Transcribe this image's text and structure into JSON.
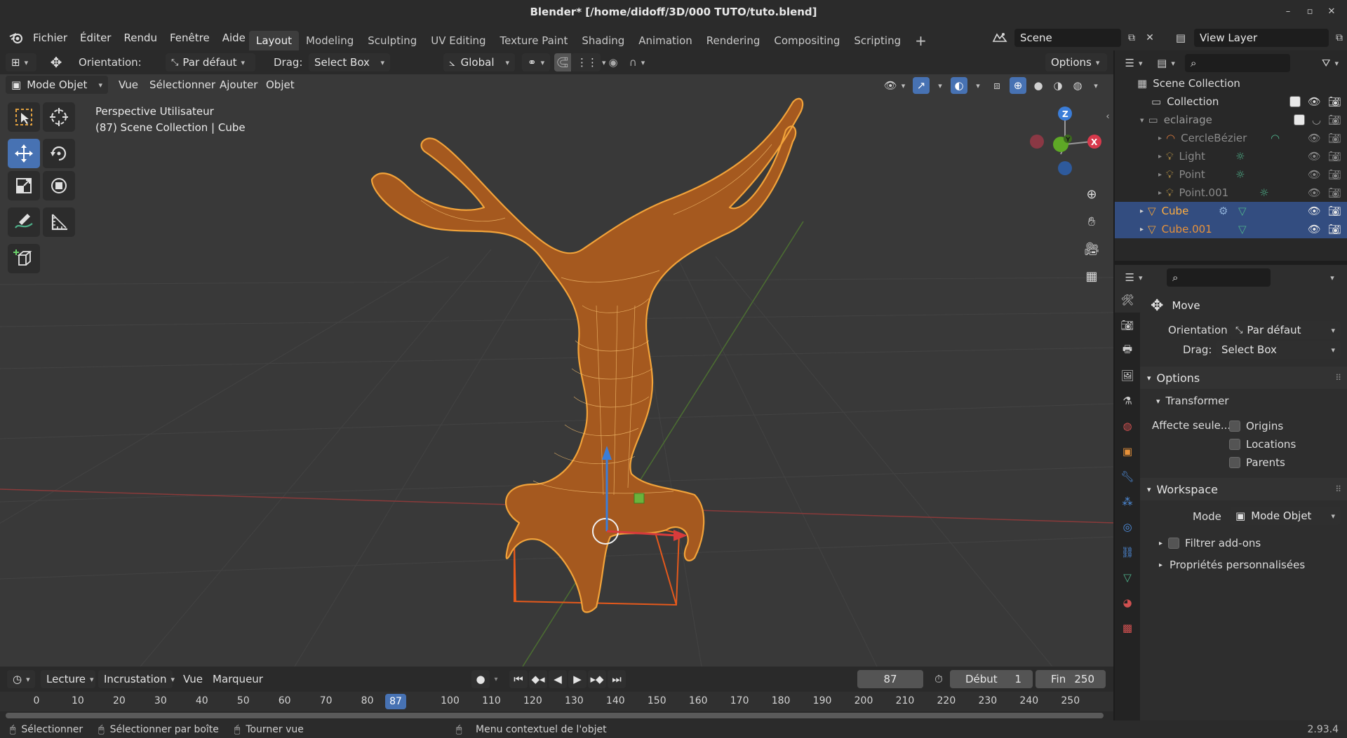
{
  "window": {
    "title": "Blender* [/home/didoff/3D/000 TUTO/tuto.blend]"
  },
  "menubar": {
    "items": [
      "Fichier",
      "Éditer",
      "Rendu",
      "Fenêtre",
      "Aide"
    ],
    "workspaces": [
      "Layout",
      "Modeling",
      "Sculpting",
      "UV Editing",
      "Texture Paint",
      "Shading",
      "Animation",
      "Rendering",
      "Compositing",
      "Scripting"
    ],
    "active_workspace": "Layout",
    "add_tab": "+",
    "scene": "Scene",
    "view_layer": "View Layer"
  },
  "tool_header": {
    "orientation_label": "Orientation:",
    "orientation_value": "Par défaut",
    "drag_label": "Drag:",
    "drag_value": "Select Box",
    "transform_orientation": "Global",
    "options_label": "Options"
  },
  "viewport_header": {
    "mode": "Mode Objet",
    "menus": [
      "Vue",
      "Sélectionner",
      "Ajouter",
      "Objet"
    ]
  },
  "viewport": {
    "view_name": "Perspective Utilisateur",
    "collection_info": "(87) Scene Collection | Cube",
    "gizmo_labels": {
      "z": "Z",
      "y": "Y",
      "x": "X"
    }
  },
  "outliner": {
    "rows": [
      {
        "label": "Scene Collection",
        "type": "scene-collection"
      },
      {
        "label": "Collection",
        "type": "collection"
      },
      {
        "label": "eclairage",
        "type": "collection"
      },
      {
        "label": "CercleBézier",
        "type": "curve"
      },
      {
        "label": "Light",
        "type": "light"
      },
      {
        "label": "Point",
        "type": "light"
      },
      {
        "label": "Point.001",
        "type": "light"
      },
      {
        "label": "Cube",
        "type": "mesh",
        "selected": true,
        "active": true
      },
      {
        "label": "Cube.001",
        "type": "mesh",
        "selected": true
      }
    ]
  },
  "properties": {
    "tool_name": "Move",
    "orientation_label": "Orientation",
    "orientation_value": "Par défaut",
    "drag_label": "Drag:",
    "drag_value": "Select Box",
    "options_panel": "Options",
    "transform_subpanel": "Transformer",
    "affect_label": "Affecte seule...",
    "affect_options": [
      "Origins",
      "Locations",
      "Parents"
    ],
    "workspace_panel": "Workspace",
    "mode_label": "Mode",
    "mode_value": "Mode Objet",
    "filter_addons": "Filtrer add-ons",
    "custom_props": "Propriétés personnalisées"
  },
  "timeline": {
    "menus": [
      "Lecture",
      "Incrustation",
      "Vue",
      "Marqueur"
    ],
    "current_frame": "87",
    "start_label": "Début",
    "start_value": "1",
    "end_label": "Fin",
    "end_value": "250",
    "ruler": [
      "0",
      "10",
      "20",
      "30",
      "40",
      "50",
      "60",
      "70",
      "80",
      "100",
      "110",
      "120",
      "130",
      "140",
      "150",
      "160",
      "170",
      "180",
      "190",
      "200",
      "210",
      "220",
      "230",
      "240",
      "250"
    ],
    "playhead": "87"
  },
  "statusbar": {
    "select": "Sélectionner",
    "box_select": "Sélectionner par boîte",
    "rotate_view": "Tourner vue",
    "context_menu": "Menu contextuel de l'objet",
    "version": "2.93.4"
  },
  "colors": {
    "accent": "#4772b3",
    "selection_orange": "#f2a33a",
    "active_orange": "#ffae40",
    "outliner_selection": "#334d80"
  }
}
